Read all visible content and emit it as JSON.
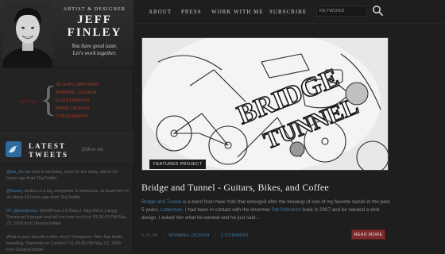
{
  "header": {
    "role": "ARTIST & DESIGNER",
    "name_first": "JEFF",
    "name_last": "FINLEY",
    "tagline_1": "You have good taste.",
    "tagline_2": "Let's work together."
  },
  "nav": {
    "items": [
      "ABOUT",
      "PRESS",
      "WORK WITH ME",
      "SUBSCRIBE"
    ],
    "search_placeholder": "KEYWORD"
  },
  "categories": {
    "prompt": "click me",
    "items": [
      "3D EXPLORATIONS",
      "APPAREL DESIGN",
      "ILLUSTRATION",
      "PRINT DESIGN",
      "TYPOGRAPHY"
    ]
  },
  "tweets": {
    "heading_1": "LATEST",
    "heading_2": "TWEETS",
    "follow": "follow me",
    "items": [
      {
        "link": "@joe_fur",
        "text": " we sent it out friday, sorry for the delay. about 13 hours ago from TinyTwitter"
      },
      {
        "link": "@frazerj",
        "text": " caribou is a big competitor to starbucks, at least here in oh about 13 hours ago from TinyTwitter"
      },
      {
        "link": "RT @wordpress",
        "text": ": WordPress 2.8 Beta 2: http://bit.ly /zkzpg Download it people and tell me how cool it is! 01:35:03 PM May 23, 2009 from DestroyTwitter"
      },
      {
        "link": "",
        "text": "What is your favorite coffee shop? Designers: Who has better branding, Starbucks or Caribou? 01:34:35 PM May 23, 2009 from DestroyTwitter"
      }
    ]
  },
  "post": {
    "badge": "FEATURED PROJECT",
    "title": "Bridge and Tunnel - Guitars, Bikes, and Coffee",
    "body_link_1": "Bridge and Tunnel",
    "body_text_1": " is a band from New York that emerged after the breakup of one of my favorite bands in the past 5 years, ",
    "body_link_2": "Latterman",
    "body_text_2": ". I had been in contact with the drummer ",
    "body_link_3": "Pat Schramm",
    "body_text_3": " back in 2007 and he needed a shirt design. I asked him what he wanted and he just said...",
    "date": "5.21.09",
    "category": "APPAREL DESIGN",
    "comments": "1 COMMENT",
    "read_more": "READ MORE"
  },
  "colors": {
    "accent_red": "#b23a28",
    "link_blue": "#3f7aa6",
    "read_more_bg": "#7a2a2a"
  }
}
